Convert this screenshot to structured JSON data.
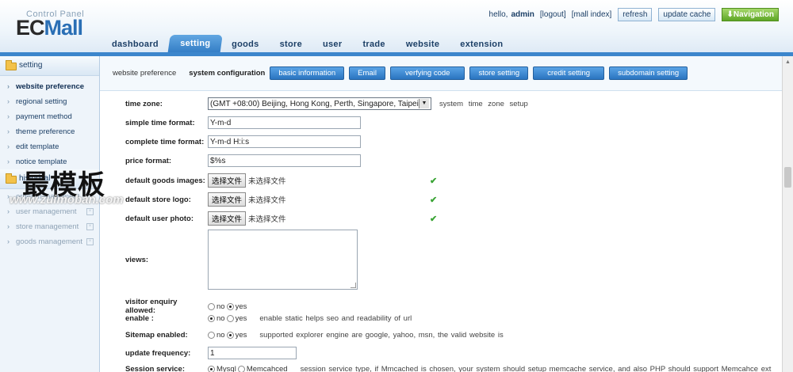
{
  "header": {
    "logo_sub": "Control Panel",
    "logo_ec": "EC",
    "logo_mall": "Mall",
    "greeting": "hello,",
    "username": "admin",
    "logout": "[logout]",
    "mall_index": "[mall  index]",
    "refresh": "refresh",
    "update_cache": "update  cache",
    "navigation": "Navigation"
  },
  "tabs": [
    "dashboard",
    "setting",
    "goods",
    "store",
    "user",
    "trade",
    "website",
    "extension"
  ],
  "sidebar": {
    "group1": "setting",
    "items": [
      "website preference",
      "regional setting",
      "payment method",
      "theme preference",
      "edit template",
      "notice template"
    ],
    "group2": "historical",
    "items2": [
      "order management",
      "user management",
      "store management",
      "goods management"
    ]
  },
  "subnav": {
    "crumb": "website preference",
    "current": "system configuration",
    "buttons": [
      "basic information",
      "Email",
      "verfying code",
      "store setting",
      "credit setting",
      "subdomain setting"
    ]
  },
  "form": {
    "time_zone_label": "time zone:",
    "time_zone_value": "(GMT +08:00) Beijing, Hong Kong, Perth, Singapore, Taipei",
    "time_zone_hint": "system time zone setup",
    "simple_time_label": "simple time format:",
    "simple_time_value": "Y-m-d",
    "complete_time_label": "complete time format:",
    "complete_time_value": "Y-m-d H:i:s",
    "price_label": "price format:",
    "price_value": "$%s",
    "goods_img_label": "default goods images:",
    "store_logo_label": "default store logo:",
    "user_photo_label": "default user photo:",
    "choose_file": "选择文件",
    "no_file": "未选择文件",
    "views_label": "views:",
    "visitor_label": "visitor enquiry allowed:",
    "enable_label": "enable :",
    "enable_hint": "enable static helps seo and readability of url",
    "sitemap_label": "Sitemap enabled:",
    "sitemap_hint": "supported explorer engine are google, yahoo, msn, the valid website is",
    "update_freq_label": "update frequency:",
    "update_freq_value": "1",
    "session_label": "Session service:",
    "session_opt1": "Mysql",
    "session_opt2": "Memcahced",
    "session_hint": "session service type, if Mmcached is chosen, your system should setup memcache service, and also PHP should support Memcahce ext",
    "no": "no",
    "yes": "yes"
  },
  "watermark": {
    "cn": "最模板",
    "url": "www.zuimoban.com"
  }
}
